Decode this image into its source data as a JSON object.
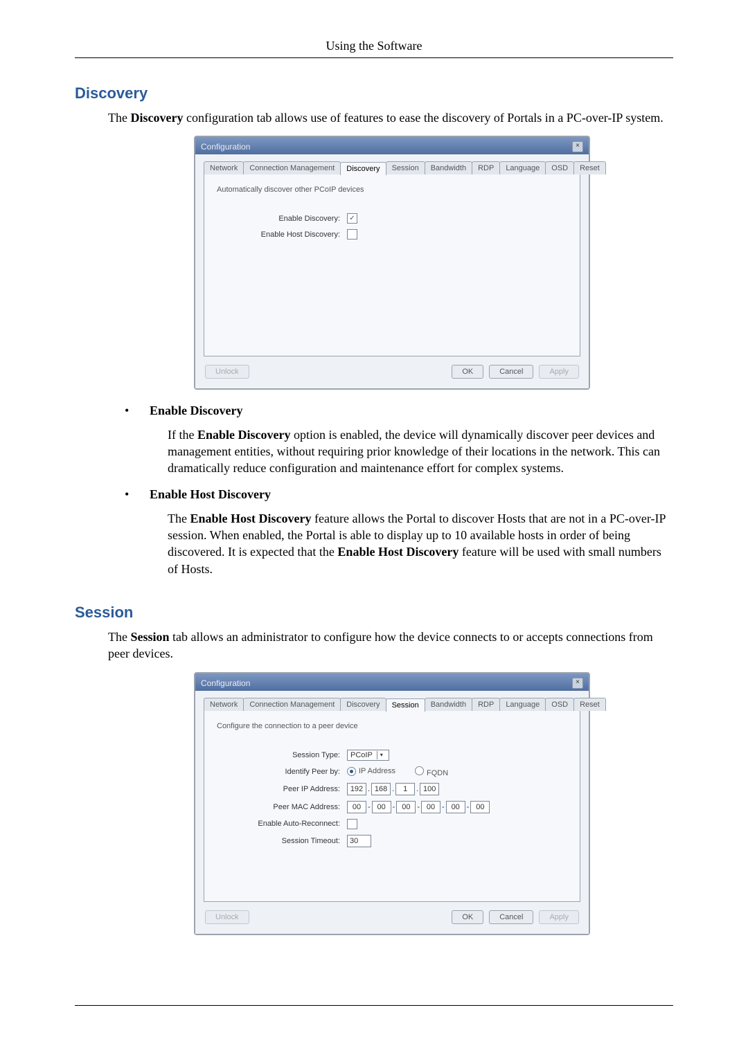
{
  "header": "Using the Software",
  "section1": {
    "heading": "Discovery",
    "intro_plain_prefix": "The ",
    "intro_strong": "Discovery",
    "intro_plain_suffix": " configuration tab allows use of features to ease the discovery of Portals in a PC-over-IP system."
  },
  "bullet1": {
    "title": "Enable Discovery",
    "body_p1": "If the ",
    "body_s1": "Enable Discovery",
    "body_p2": " option is enabled, the device will dynamically discover peer devices and management entities, without requiring prior knowledge of their locations in the network. This can dramatically reduce configuration and maintenance effort for complex systems."
  },
  "bullet2": {
    "title": "Enable Host Discovery",
    "body_p1": "The ",
    "body_s1": "Enable Host Discovery",
    "body_p2": " feature allows the Portal to discover Hosts that are not in a PC-over-IP session. When enabled, the Portal is able to display up to 10 available hosts in order of being discovered. It is expected that the ",
    "body_s2": "Enable Host Discovery",
    "body_p3": " feature will be used with small numbers of Hosts."
  },
  "section2": {
    "heading": "Session",
    "intro_plain_prefix": "The ",
    "intro_strong": "Session",
    "intro_plain_suffix": " tab allows an administrator to configure how the device connects to or accepts connections from peer devices."
  },
  "window_common": {
    "title": "Configuration",
    "close_label": "×",
    "tabs": {
      "network": "Network",
      "conn_mgmt": "Connection Management",
      "discovery": "Discovery",
      "session": "Session",
      "bandwidth": "Bandwidth",
      "rdp": "RDP",
      "language": "Language",
      "osd": "OSD",
      "reset": "Reset"
    },
    "buttons": {
      "unlock": "Unlock",
      "ok": "OK",
      "cancel": "Cancel",
      "apply": "Apply"
    }
  },
  "discovery_panel": {
    "desc": "Automatically discover other PCoIP devices",
    "labels": {
      "enable_discovery": "Enable Discovery:",
      "enable_host_discovery": "Enable Host Discovery:"
    },
    "values": {
      "enable_discovery_checked": true,
      "enable_host_discovery_checked": false
    }
  },
  "session_panel": {
    "desc": "Configure the connection to a peer device",
    "labels": {
      "session_type": "Session Type:",
      "identify_by": "Identify Peer by:",
      "peer_ip": "Peer IP Address:",
      "peer_mac": "Peer MAC Address:",
      "auto_reconnect": "Enable Auto-Reconnect:",
      "session_timeout": "Session Timeout:"
    },
    "values": {
      "session_type": "PCoIP",
      "identify_by_ip": "IP Address",
      "identify_by_fqdn": "FQDN",
      "ip": {
        "a": "192",
        "b": "168",
        "c": "1",
        "d": "100"
      },
      "mac": {
        "a": "00",
        "b": "00",
        "c": "00",
        "d": "00",
        "e": "00",
        "f": "00"
      },
      "auto_reconnect_checked": false,
      "session_timeout": "30"
    }
  }
}
